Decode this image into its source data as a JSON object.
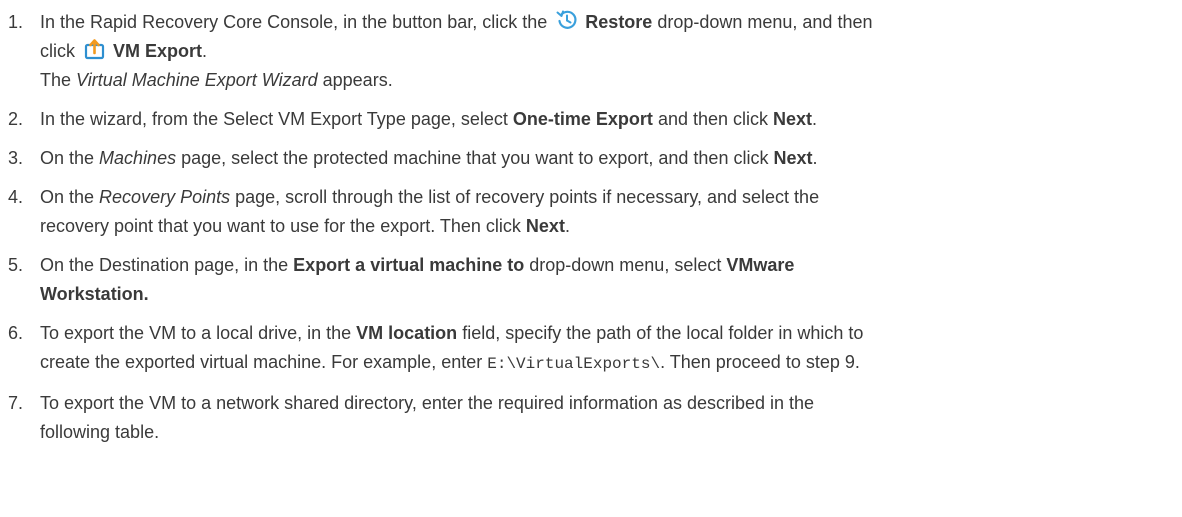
{
  "steps": [
    {
      "num": "1.",
      "parts": [
        {
          "t": "In the Rapid Recovery Core Console, in the button bar, click the "
        },
        {
          "icon": "restore-icon",
          "name": "restore-icon"
        },
        {
          "t": " "
        },
        {
          "t": "Restore",
          "b": true
        },
        {
          "t": " drop-down menu, and then"
        },
        {
          "br": true
        },
        {
          "t": "click "
        },
        {
          "icon": "vm-export-icon",
          "name": "vm-export-icon"
        },
        {
          "t": " "
        },
        {
          "t": "VM Export",
          "b": true
        },
        {
          "t": "."
        },
        {
          "br": true
        },
        {
          "t": "The "
        },
        {
          "t": "Virtual Machine Export Wizard",
          "i": true
        },
        {
          "t": " appears."
        }
      ]
    },
    {
      "num": "2.",
      "parts": [
        {
          "t": "In the wizard, from the Select VM Export Type page, select "
        },
        {
          "t": "One-time Export",
          "b": true
        },
        {
          "t": " and then click "
        },
        {
          "t": "Next",
          "b": true
        },
        {
          "t": "."
        }
      ]
    },
    {
      "num": "3.",
      "parts": [
        {
          "t": "On the "
        },
        {
          "t": "Machines",
          "i": true
        },
        {
          "t": " page, select the protected machine that you want to export, and then click "
        },
        {
          "t": "Next",
          "b": true
        },
        {
          "t": "."
        }
      ]
    },
    {
      "num": "4.",
      "parts": [
        {
          "t": "On the "
        },
        {
          "t": "Recovery Points",
          "i": true
        },
        {
          "t": " page, scroll through the list of recovery points if necessary, and select the"
        },
        {
          "br": true
        },
        {
          "t": "recovery point that you want to use for the export. Then click "
        },
        {
          "t": "Next",
          "b": true
        },
        {
          "t": "."
        }
      ]
    },
    {
      "num": "5.",
      "parts": [
        {
          "t": "On the Destination page, in the "
        },
        {
          "t": "Export a virtual machine to",
          "b": true
        },
        {
          "t": " drop-down menu, select "
        },
        {
          "t": "VMware",
          "b": true
        },
        {
          "br": true
        },
        {
          "t": "Workstation.",
          "b": true
        }
      ]
    },
    {
      "num": "6.",
      "parts": [
        {
          "t": "To export the VM to a local drive, in the "
        },
        {
          "t": "VM location",
          "b": true
        },
        {
          "t": " field, specify the path of the local folder in which to"
        },
        {
          "br": true
        },
        {
          "t": "create the exported virtual machine. For example, enter "
        },
        {
          "t": "E:\\VirtualExports\\",
          "mono": true
        },
        {
          "t": ". Then proceed to step 9."
        }
      ]
    },
    {
      "num": "7.",
      "parts": [
        {
          "t": "To export the VM to a network shared directory, enter the required information as described in the"
        },
        {
          "br": true
        },
        {
          "t": "following table."
        }
      ]
    }
  ],
  "colors": {
    "text": "#3a3a3a",
    "restore_icon": "#3aa0dc",
    "vm_export_icon_border": "#2e8fd0",
    "vm_export_icon_arrow": "#f39a1e"
  }
}
